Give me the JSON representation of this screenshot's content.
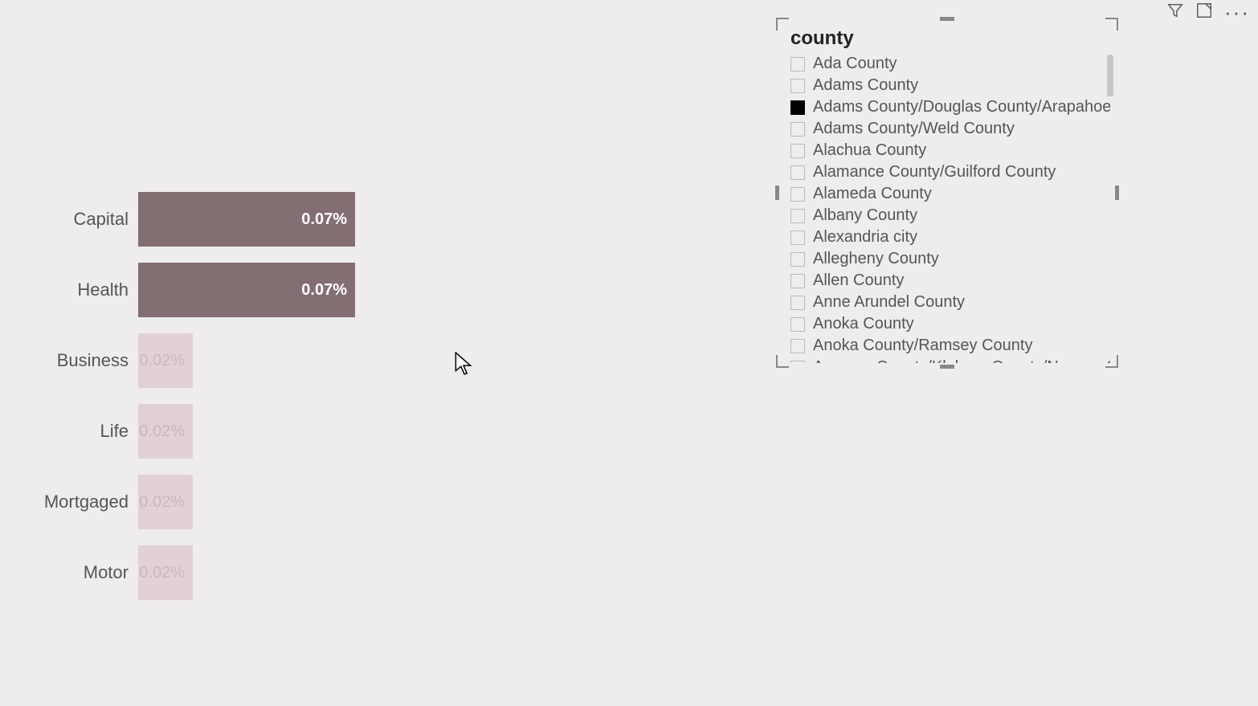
{
  "chart_data": {
    "type": "bar",
    "orientation": "horizontal",
    "categories": [
      "Capital",
      "Health",
      "Business",
      "Life",
      "Mortgaged",
      "Motor"
    ],
    "values": [
      0.07,
      0.07,
      0.02,
      0.02,
      0.02,
      0.02
    ],
    "value_labels": [
      "0.07%",
      "0.07%",
      "0.02%",
      "0.02%",
      "0.02%",
      "0.02%"
    ],
    "highlighted": [
      true,
      true,
      false,
      false,
      false,
      false
    ],
    "title": "",
    "xlabel": "",
    "ylabel": "",
    "ylim": [
      0,
      0.1
    ]
  },
  "slicer": {
    "title": "county",
    "items": [
      {
        "label": "Ada County",
        "checked": false
      },
      {
        "label": "Adams County",
        "checked": false
      },
      {
        "label": "Adams County/Douglas County/Arapahoe ...",
        "checked": true
      },
      {
        "label": "Adams County/Weld County",
        "checked": false
      },
      {
        "label": "Alachua County",
        "checked": false
      },
      {
        "label": "Alamance County/Guilford County",
        "checked": false
      },
      {
        "label": "Alameda County",
        "checked": false
      },
      {
        "label": "Albany County",
        "checked": false
      },
      {
        "label": "Alexandria city",
        "checked": false
      },
      {
        "label": "Allegheny County",
        "checked": false
      },
      {
        "label": "Allen County",
        "checked": false
      },
      {
        "label": "Anne Arundel County",
        "checked": false
      },
      {
        "label": "Anoka County",
        "checked": false
      },
      {
        "label": "Anoka County/Ramsey County",
        "checked": false
      },
      {
        "label": "Aransas County/Kleberg County/Nueces C...",
        "checked": false
      }
    ]
  },
  "toolbar": {
    "filter_tip": "Filters",
    "focus_tip": "Focus mode",
    "more_tip": "More options"
  }
}
